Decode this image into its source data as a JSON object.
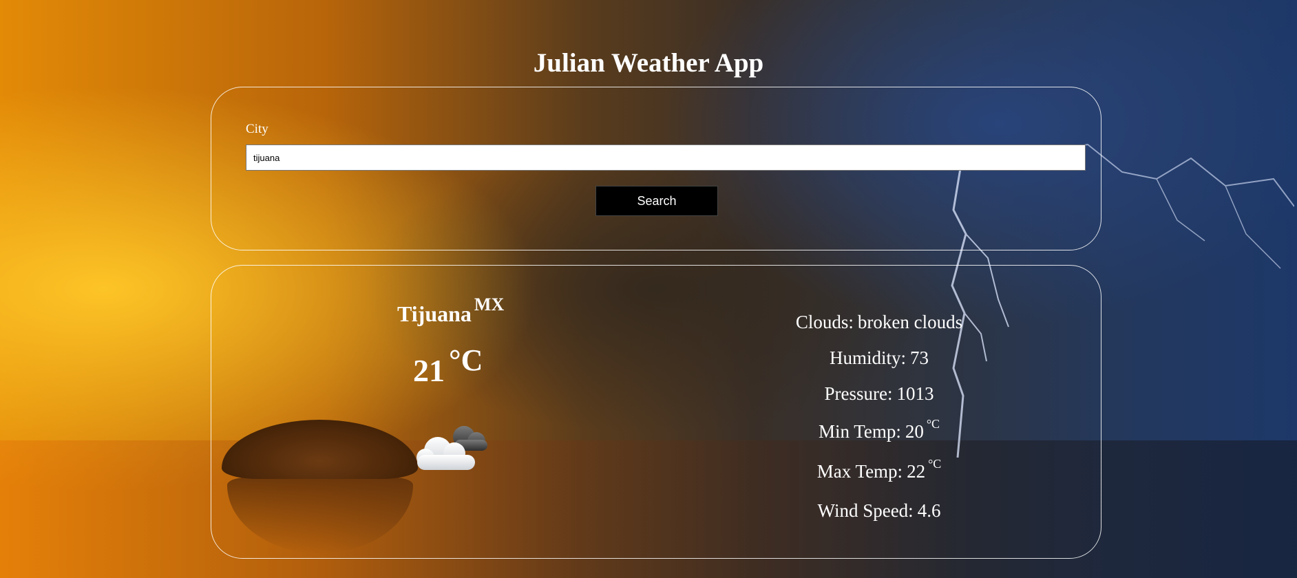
{
  "app": {
    "title": "Julian Weather App"
  },
  "search": {
    "label": "City",
    "value": "tijuana",
    "button_label": "Search"
  },
  "weather": {
    "city": "Tijuana",
    "country": "MX",
    "temperature": "21",
    "temp_unit": "°C",
    "icon": "broken-clouds-icon",
    "details": {
      "clouds_label": "Clouds:",
      "clouds_value": "broken clouds",
      "humidity_label": "Humidity:",
      "humidity_value": "73",
      "pressure_label": "Pressure:",
      "pressure_value": "1013",
      "min_temp_label": "Min Temp:",
      "min_temp_value": "20",
      "max_temp_label": "Max Temp:",
      "max_temp_value": "22",
      "unit": "°C",
      "wind_label": "Wind Speed:",
      "wind_value": "4.6"
    }
  },
  "colors": {
    "text": "#ffffff",
    "button_bg": "#000000",
    "panel_border": "#ffffff"
  }
}
